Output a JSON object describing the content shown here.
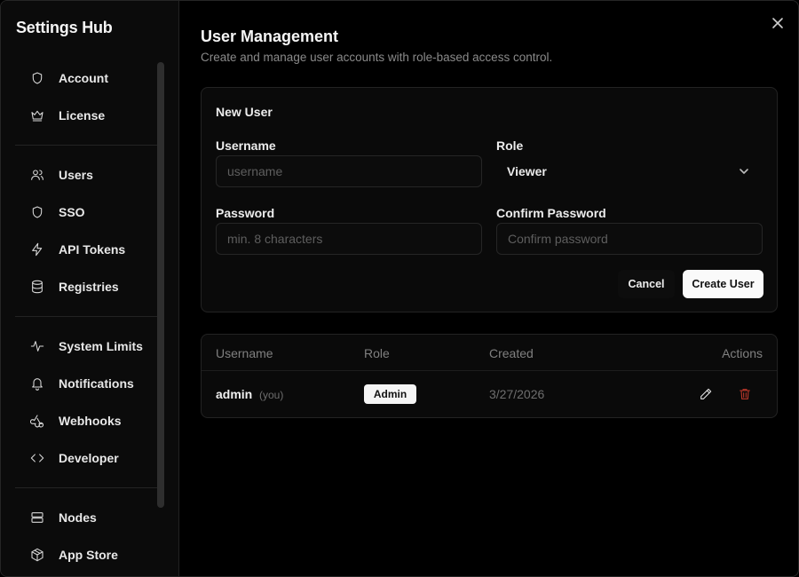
{
  "app": {
    "title": "Settings Hub"
  },
  "sidebar": {
    "groups": [
      {
        "items": [
          {
            "label": "Account",
            "icon": "shield-icon"
          },
          {
            "label": "License",
            "icon": "crown-icon"
          }
        ]
      },
      {
        "items": [
          {
            "label": "Users",
            "icon": "users-icon"
          },
          {
            "label": "SSO",
            "icon": "shield-icon"
          },
          {
            "label": "API Tokens",
            "icon": "lightning-icon"
          },
          {
            "label": "Registries",
            "icon": "database-icon"
          }
        ]
      },
      {
        "items": [
          {
            "label": "System Limits",
            "icon": "activity-icon"
          },
          {
            "label": "Notifications",
            "icon": "bell-icon"
          },
          {
            "label": "Webhooks",
            "icon": "webhook-icon"
          },
          {
            "label": "Developer",
            "icon": "code-icon"
          }
        ]
      },
      {
        "items": [
          {
            "label": "Nodes",
            "icon": "server-icon"
          },
          {
            "label": "App Store",
            "icon": "package-icon"
          }
        ]
      }
    ]
  },
  "main": {
    "title": "User Management",
    "subtitle": "Create and manage user accounts with role-based access control."
  },
  "form": {
    "title": "New User",
    "username_label": "Username",
    "username_placeholder": "username",
    "username_value": "",
    "role_label": "Role",
    "role_value": "Viewer",
    "password_label": "Password",
    "password_placeholder": "min. 8 characters",
    "confirm_label": "Confirm Password",
    "confirm_placeholder": "Confirm password",
    "cancel_label": "Cancel",
    "create_label": "Create User"
  },
  "table": {
    "headers": {
      "username": "Username",
      "role": "Role",
      "created": "Created",
      "actions": "Actions"
    },
    "rows": [
      {
        "username": "admin",
        "suffix": "(you)",
        "role": "Admin",
        "created": "3/27/2026"
      }
    ]
  },
  "colors": {
    "danger": "#c0392b",
    "accent": "#fafafa",
    "background": "#000000"
  }
}
